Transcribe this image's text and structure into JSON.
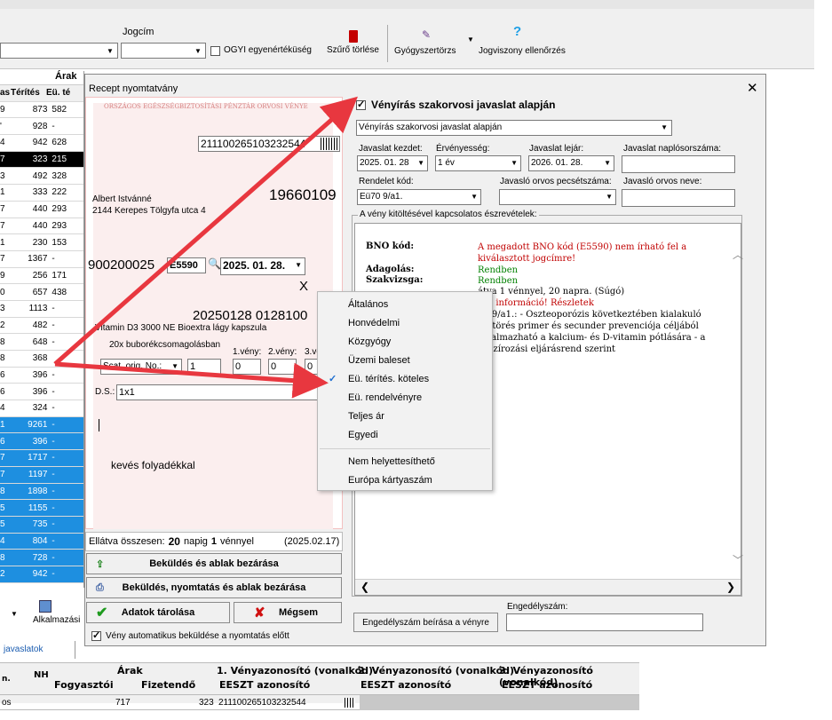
{
  "toolbar": {
    "jogcim_label": "Jogcím",
    "ogyi_label": "OGYI egyenértéküség",
    "szuro_torles": "Szűrő törlése",
    "gyogyszertorzs": "Gyógyszertörzs",
    "jogviszony": "Jogviszony ellenőrzés"
  },
  "grid_header": {
    "arak": "Árak",
    "col1": "as",
    "col2": "Térítés",
    "col3": "Eü. té"
  },
  "grid_rows": [
    {
      "a": "9",
      "b": "873",
      "c": "582",
      "style": ""
    },
    {
      "a": "'",
      "b": "928",
      "c": "-",
      "style": ""
    },
    {
      "a": "4",
      "b": "942",
      "c": "628",
      "style": ""
    },
    {
      "a": "7",
      "b": "323",
      "c": "215",
      "style": "hl"
    },
    {
      "a": "3",
      "b": "492",
      "c": "328",
      "style": ""
    },
    {
      "a": "1",
      "b": "333",
      "c": "222",
      "style": ""
    },
    {
      "a": "7",
      "b": "440",
      "c": "293",
      "style": ""
    },
    {
      "a": "7",
      "b": "440",
      "c": "293",
      "style": ""
    },
    {
      "a": "1",
      "b": "230",
      "c": "153",
      "style": ""
    },
    {
      "a": "7",
      "b": "1367",
      "c": "-",
      "style": ""
    },
    {
      "a": "9",
      "b": "256",
      "c": "171",
      "style": ""
    },
    {
      "a": "0",
      "b": "657",
      "c": "438",
      "style": ""
    },
    {
      "a": "3",
      "b": "1113",
      "c": "-",
      "style": ""
    },
    {
      "a": "2",
      "b": "482",
      "c": "-",
      "style": ""
    },
    {
      "a": "8",
      "b": "648",
      "c": "-",
      "style": ""
    },
    {
      "a": "8",
      "b": "368",
      "c": "",
      "style": ""
    },
    {
      "a": "6",
      "b": "396",
      "c": "-",
      "style": ""
    },
    {
      "a": "6",
      "b": "396",
      "c": "-",
      "style": ""
    },
    {
      "a": "4",
      "b": "324",
      "c": "-",
      "style": ""
    },
    {
      "a": "1",
      "b": "9261",
      "c": "-",
      "style": "bl"
    },
    {
      "a": "6",
      "b": "396",
      "c": "-",
      "style": "bl"
    },
    {
      "a": "7",
      "b": "1717",
      "c": "-",
      "style": "bl"
    },
    {
      "a": "7",
      "b": "1197",
      "c": "-",
      "style": "bl"
    },
    {
      "a": "8",
      "b": "1898",
      "c": "-",
      "style": "bl"
    },
    {
      "a": "5",
      "b": "1155",
      "c": "-",
      "style": "bl"
    },
    {
      "a": "5",
      "b": "735",
      "c": "-",
      "style": "bl"
    },
    {
      "a": "4",
      "b": "804",
      "c": "-",
      "style": "bl"
    },
    {
      "a": "8",
      "b": "728",
      "c": "-",
      "style": "bl"
    },
    {
      "a": "2",
      "b": "942",
      "c": "-",
      "style": "bl"
    }
  ],
  "dialog": {
    "title": "Recept nyomtatvány",
    "form_header": "ORSZÁGOS EGÉSZSÉGBIZTOSÍTÁSI PÉNZTÁR ORVOSI VÉNYE",
    "barcode_id": "211100265103232544",
    "patient_name": "Albert Istvánné",
    "patient_address": "2144  Kerepes Tölgyfa utca 4",
    "patient_birth": "19660109",
    "code_prefix": "900200025",
    "code_box": "E5590",
    "date_value": "2025. 01. 28.",
    "x_mark": "X",
    "rx_number": "20250128  0128100",
    "drug_name": "Vitamin D3 3000 NE Bioextra lágy kapszula",
    "drug_pack": "20x buborékcsomagolásban",
    "veny1": "1.vény:",
    "veny2": "2.vény:",
    "veny3": "3.ve",
    "scat": "Scat. orig. No.:",
    "scat_val": "1",
    "v1_val": "0",
    "v2_val": "0",
    "v3_val": "0",
    "ds_label": "D.S.:",
    "ds_value": "1x1",
    "note": "kevés folyadékkal",
    "ellatva_label": "Ellátva összesen:",
    "ellatva_days": "20",
    "ellatva_mid": "napig",
    "ellatva_count": "1",
    "ellatva_unit": "vénnyel",
    "ellatva_date": "(2025.02.17)",
    "btn_send_close": "Beküldés és ablak bezárása",
    "btn_send_print_close": "Beküldés, nyomtatás és ablak bezárása",
    "btn_save": "Adatok tárolása",
    "btn_cancel": "Mégsem",
    "auto_send_label": "Vény automatikus beküldése a nyomtatás előtt",
    "close_glyph": "✕"
  },
  "right": {
    "szakorvosi_label": "Vényírás szakorvosi javaslat alapján",
    "szakorvosi_select": "Vényírás szakorvosi javaslat alapján",
    "javaslat_kezdet_label": "Javaslat kezdet:",
    "javaslat_kezdet": "2025. 01. 28",
    "ervenyesseg_label": "Érvényesség:",
    "ervenyesseg": "1 év",
    "javaslat_lejar_label": "Javaslat lejár:",
    "javaslat_lejar": "2026. 01. 28.",
    "naplo_label": "Javaslat naplósorszáma:",
    "rendelet_label": "Rendelet kód:",
    "rendelet": "Eü70 9/a1.",
    "pecset_label": "Javasló orvos pecsétszáma:",
    "orvos_neve_label": "Javasló orvos neve:",
    "group_label": "A vény kitöltésével kapcsolatos észrevételek:",
    "bno_label": "BNO kód:",
    "bno_text": "A megadott BNO kód (E5590) nem írható fel a kiválasztott jogcímre!",
    "adagolas_label": "Adagolás:",
    "adagolas_val": "Rendben",
    "szakvizsga_label": "Szakvizsga:",
    "szakvizsga_val": "Rendben",
    "line1": "átva 1 vénnyel, 20 napra. (Súgó)",
    "line2": "ncs információ! Részletek",
    "line3": "70 9/a1.: - Oszteoporózis következtében kialakuló",
    "line4": "enttörés primer és secunder prevenciója céljából",
    "line5": "alkalmazható a kalcium- és D-vitamin pótlására - a",
    "line6": "anszírozási eljárásrend szerint",
    "engedely_label": "Engedélyszám:",
    "engedely_btn": "Engedélyszám beírása a vényre"
  },
  "menu": {
    "items": [
      "Általános",
      "Honvédelmi",
      "Közgyógy",
      "Üzemi baleset",
      "Eü. térítés. köteles",
      "Eü. rendelvényre",
      "Teljes ár",
      "Egyedi"
    ],
    "items2": [
      "Nem helyettesíthető",
      "Európa kártyaszám"
    ],
    "checked": "Eü. térítés. köteles"
  },
  "lower": {
    "tab": "javaslatok",
    "alkalmazasi": "Alkalmazási",
    "h_n": "n.",
    "h_nh": "NH",
    "h_arak": "Árak",
    "h_fogyasztoi": "Fogyasztói",
    "h_fizetendo": "Fizetendő",
    "h_v1": "1. Vényazonosító (vonalkód)",
    "h_v2": "2. Vényazonosító (vonalkód)",
    "h_v3": "3. Vényazonosító (vonalkód)",
    "h_eeszt": "EESZT azonosító",
    "r_first": "os",
    "r_fogy": "717",
    "r_fiz": "323",
    "r_eeszt": "211100265103232544"
  },
  "colors": {
    "arrow": "#e8373f",
    "selection": "#1e8fe0",
    "warn": "#c00000",
    "ok": "#008000"
  }
}
